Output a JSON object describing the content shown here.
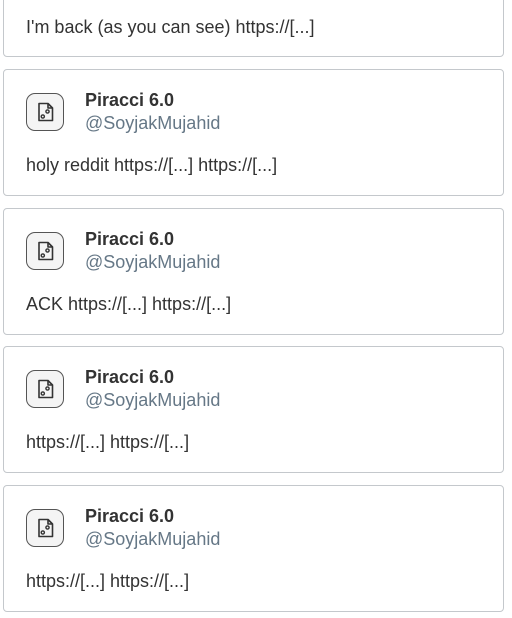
{
  "posts": [
    {
      "text": "I'm back (as you can see) https://[...]"
    },
    {
      "author_name": "Piracci 6.0",
      "author_handle": "@SoyjakMujahid",
      "avatar_icon": "image-file-icon",
      "text": "holy reddit https://[...] https://[...]"
    },
    {
      "author_name": "Piracci 6.0",
      "author_handle": "@SoyjakMujahid",
      "avatar_icon": "image-file-icon",
      "text": "ACK https://[...] https://[...]"
    },
    {
      "author_name": "Piracci 6.0",
      "author_handle": "@SoyjakMujahid",
      "avatar_icon": "image-file-icon",
      "text": "https://[...] https://[...]"
    },
    {
      "author_name": "Piracci 6.0",
      "author_handle": "@SoyjakMujahid",
      "avatar_icon": "image-file-icon",
      "text": "https://[...] https://[...]"
    }
  ]
}
